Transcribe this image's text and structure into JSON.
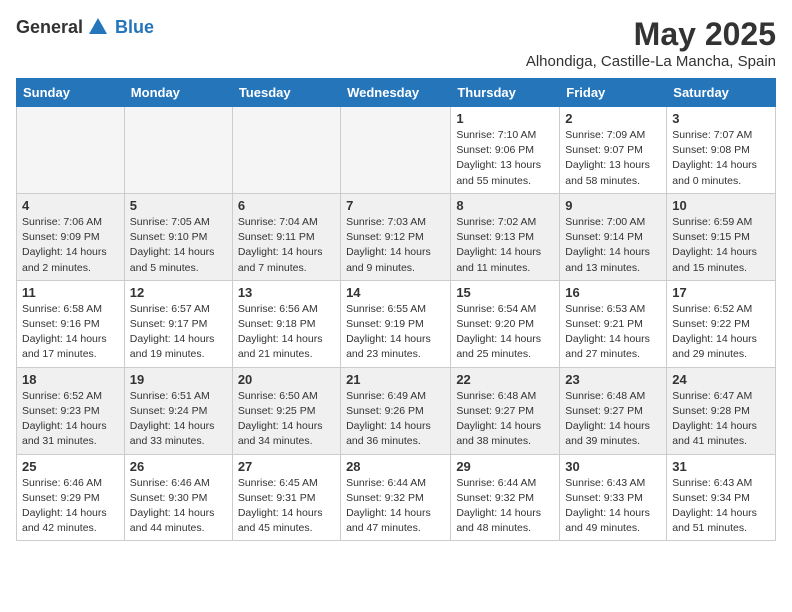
{
  "logo": {
    "general": "General",
    "blue": "Blue"
  },
  "title": "May 2025",
  "subtitle": "Alhondiga, Castille-La Mancha, Spain",
  "days": [
    "Sunday",
    "Monday",
    "Tuesday",
    "Wednesday",
    "Thursday",
    "Friday",
    "Saturday"
  ],
  "weeks": [
    [
      {
        "num": "",
        "text": ""
      },
      {
        "num": "",
        "text": ""
      },
      {
        "num": "",
        "text": ""
      },
      {
        "num": "",
        "text": ""
      },
      {
        "num": "1",
        "text": "Sunrise: 7:10 AM\nSunset: 9:06 PM\nDaylight: 13 hours\nand 55 minutes."
      },
      {
        "num": "2",
        "text": "Sunrise: 7:09 AM\nSunset: 9:07 PM\nDaylight: 13 hours\nand 58 minutes."
      },
      {
        "num": "3",
        "text": "Sunrise: 7:07 AM\nSunset: 9:08 PM\nDaylight: 14 hours\nand 0 minutes."
      }
    ],
    [
      {
        "num": "4",
        "text": "Sunrise: 7:06 AM\nSunset: 9:09 PM\nDaylight: 14 hours\nand 2 minutes."
      },
      {
        "num": "5",
        "text": "Sunrise: 7:05 AM\nSunset: 9:10 PM\nDaylight: 14 hours\nand 5 minutes."
      },
      {
        "num": "6",
        "text": "Sunrise: 7:04 AM\nSunset: 9:11 PM\nDaylight: 14 hours\nand 7 minutes."
      },
      {
        "num": "7",
        "text": "Sunrise: 7:03 AM\nSunset: 9:12 PM\nDaylight: 14 hours\nand 9 minutes."
      },
      {
        "num": "8",
        "text": "Sunrise: 7:02 AM\nSunset: 9:13 PM\nDaylight: 14 hours\nand 11 minutes."
      },
      {
        "num": "9",
        "text": "Sunrise: 7:00 AM\nSunset: 9:14 PM\nDaylight: 14 hours\nand 13 minutes."
      },
      {
        "num": "10",
        "text": "Sunrise: 6:59 AM\nSunset: 9:15 PM\nDaylight: 14 hours\nand 15 minutes."
      }
    ],
    [
      {
        "num": "11",
        "text": "Sunrise: 6:58 AM\nSunset: 9:16 PM\nDaylight: 14 hours\nand 17 minutes."
      },
      {
        "num": "12",
        "text": "Sunrise: 6:57 AM\nSunset: 9:17 PM\nDaylight: 14 hours\nand 19 minutes."
      },
      {
        "num": "13",
        "text": "Sunrise: 6:56 AM\nSunset: 9:18 PM\nDaylight: 14 hours\nand 21 minutes."
      },
      {
        "num": "14",
        "text": "Sunrise: 6:55 AM\nSunset: 9:19 PM\nDaylight: 14 hours\nand 23 minutes."
      },
      {
        "num": "15",
        "text": "Sunrise: 6:54 AM\nSunset: 9:20 PM\nDaylight: 14 hours\nand 25 minutes."
      },
      {
        "num": "16",
        "text": "Sunrise: 6:53 AM\nSunset: 9:21 PM\nDaylight: 14 hours\nand 27 minutes."
      },
      {
        "num": "17",
        "text": "Sunrise: 6:52 AM\nSunset: 9:22 PM\nDaylight: 14 hours\nand 29 minutes."
      }
    ],
    [
      {
        "num": "18",
        "text": "Sunrise: 6:52 AM\nSunset: 9:23 PM\nDaylight: 14 hours\nand 31 minutes."
      },
      {
        "num": "19",
        "text": "Sunrise: 6:51 AM\nSunset: 9:24 PM\nDaylight: 14 hours\nand 33 minutes."
      },
      {
        "num": "20",
        "text": "Sunrise: 6:50 AM\nSunset: 9:25 PM\nDaylight: 14 hours\nand 34 minutes."
      },
      {
        "num": "21",
        "text": "Sunrise: 6:49 AM\nSunset: 9:26 PM\nDaylight: 14 hours\nand 36 minutes."
      },
      {
        "num": "22",
        "text": "Sunrise: 6:48 AM\nSunset: 9:27 PM\nDaylight: 14 hours\nand 38 minutes."
      },
      {
        "num": "23",
        "text": "Sunrise: 6:48 AM\nSunset: 9:27 PM\nDaylight: 14 hours\nand 39 minutes."
      },
      {
        "num": "24",
        "text": "Sunrise: 6:47 AM\nSunset: 9:28 PM\nDaylight: 14 hours\nand 41 minutes."
      }
    ],
    [
      {
        "num": "25",
        "text": "Sunrise: 6:46 AM\nSunset: 9:29 PM\nDaylight: 14 hours\nand 42 minutes."
      },
      {
        "num": "26",
        "text": "Sunrise: 6:46 AM\nSunset: 9:30 PM\nDaylight: 14 hours\nand 44 minutes."
      },
      {
        "num": "27",
        "text": "Sunrise: 6:45 AM\nSunset: 9:31 PM\nDaylight: 14 hours\nand 45 minutes."
      },
      {
        "num": "28",
        "text": "Sunrise: 6:44 AM\nSunset: 9:32 PM\nDaylight: 14 hours\nand 47 minutes."
      },
      {
        "num": "29",
        "text": "Sunrise: 6:44 AM\nSunset: 9:32 PM\nDaylight: 14 hours\nand 48 minutes."
      },
      {
        "num": "30",
        "text": "Sunrise: 6:43 AM\nSunset: 9:33 PM\nDaylight: 14 hours\nand 49 minutes."
      },
      {
        "num": "31",
        "text": "Sunrise: 6:43 AM\nSunset: 9:34 PM\nDaylight: 14 hours\nand 51 minutes."
      }
    ]
  ]
}
